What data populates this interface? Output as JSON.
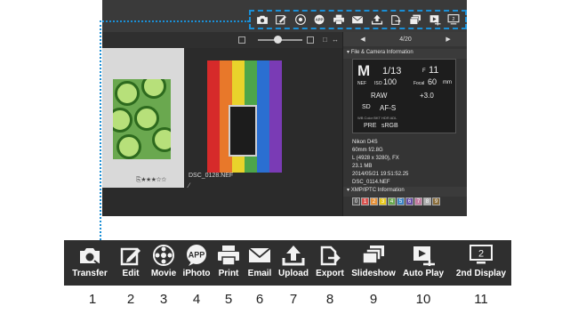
{
  "thumbnail_view": {
    "rating": "⎘★★★☆☆",
    "selected_filename": "DSC_0128.NEF"
  },
  "navigator": {
    "prev": "◀",
    "counter": "4/20",
    "next": "▶"
  },
  "file_camera_panel": {
    "title": "File & Camera Information",
    "mode": "M",
    "shutter": "1/13",
    "aperture_prefix": "F",
    "aperture": "11",
    "nef": "NEF",
    "iso_label": "ISO",
    "iso": "100",
    "focal_label": "Focal",
    "focal": "60",
    "focal_unit": "mm",
    "raw": "RAW",
    "exposure_comp": "+3.0",
    "card": "SD",
    "focus": "AF-S",
    "row_labels": "WB   Color   BKT   HDR   ADL",
    "wb": "PRE",
    "color_space": "sRGB",
    "metadata": [
      "Nikon D4S",
      "60mm f/2.8G",
      "L (4928 x 3280), FX",
      "23.1 MB",
      "2014/05/21 19:51:52.25",
      "DSC_0114.NEF"
    ]
  },
  "xmp_panel": {
    "title": "XMP/IPTC Information",
    "labels": [
      "0",
      "1",
      "2",
      "3",
      "4",
      "5",
      "6",
      "7",
      "8",
      "9"
    ],
    "label_colors": [
      "#555555",
      "#d9534f",
      "#e69138",
      "#e6c619",
      "#6aa84f",
      "#3d85c6",
      "#674ea7",
      "#c27ba0",
      "#b0b0b0",
      "#8a6d3b"
    ]
  },
  "toolbar": {
    "buttons": [
      {
        "id": "transfer",
        "label": "Transfer",
        "number": "1",
        "icon": "camera-transfer-icon"
      },
      {
        "id": "edit",
        "label": "Edit",
        "number": "2",
        "icon": "edit-pencil-icon"
      },
      {
        "id": "movie",
        "label": "Movie",
        "number": "3",
        "icon": "film-reel-icon"
      },
      {
        "id": "iphoto",
        "label": "iPhoto",
        "number": "4",
        "icon": "app-badge-icon"
      },
      {
        "id": "print",
        "label": "Print",
        "number": "5",
        "icon": "printer-icon"
      },
      {
        "id": "email",
        "label": "Email",
        "number": "6",
        "icon": "envelope-icon"
      },
      {
        "id": "upload",
        "label": "Upload",
        "number": "7",
        "icon": "upload-arrow-icon"
      },
      {
        "id": "export",
        "label": "Export",
        "number": "8",
        "icon": "export-icon"
      },
      {
        "id": "slideshow",
        "label": "Slideshow",
        "number": "9",
        "icon": "slideshow-icon"
      },
      {
        "id": "autoplay",
        "label": "Auto Play",
        "number": "10",
        "icon": "auto-play-icon"
      },
      {
        "id": "display2",
        "label": "2nd Display",
        "number": "11",
        "icon": "second-display-icon",
        "glyph": "2"
      }
    ]
  },
  "colors": {
    "highlight": "#1a8fd6",
    "toolbar_bg": "#2f2f2f",
    "icon": "#f2f2f2"
  }
}
